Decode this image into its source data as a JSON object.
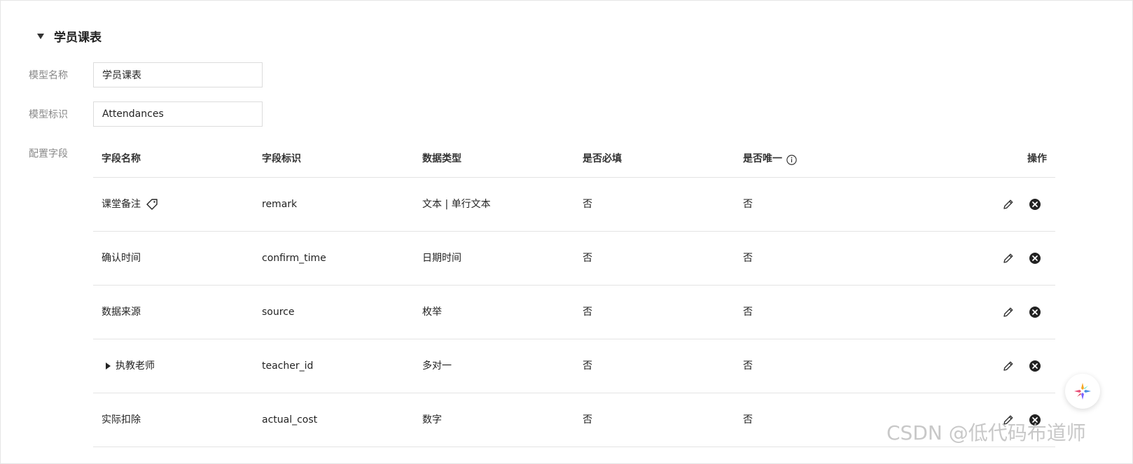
{
  "section": {
    "title": "学员课表"
  },
  "form": {
    "model_name_label": "模型名称",
    "model_name_value": "学员课表",
    "model_id_label": "模型标识",
    "model_id_value": "Attendances",
    "fields_label": "配置字段"
  },
  "table": {
    "headers": {
      "field_name": "字段名称",
      "field_id": "字段标识",
      "data_type": "数据类型",
      "required": "是否必填",
      "unique": "是否唯一",
      "actions": "操作"
    },
    "rows": [
      {
        "name": "课堂备注",
        "id": "remark",
        "type": "文本 | 单行文本",
        "required": "否",
        "unique": "否",
        "has_tag": true,
        "expandable": false
      },
      {
        "name": "确认时间",
        "id": "confirm_time",
        "type": "日期时间",
        "required": "否",
        "unique": "否",
        "has_tag": false,
        "expandable": false
      },
      {
        "name": "数据来源",
        "id": "source",
        "type": "枚举",
        "required": "否",
        "unique": "否",
        "has_tag": false,
        "expandable": false
      },
      {
        "name": "执教老师",
        "id": "teacher_id",
        "type": "多对一",
        "required": "否",
        "unique": "否",
        "has_tag": false,
        "expandable": true
      },
      {
        "name": "实际扣除",
        "id": "actual_cost",
        "type": "数字",
        "required": "否",
        "unique": "否",
        "has_tag": false,
        "expandable": false
      }
    ]
  },
  "icons": {
    "section_caret": "caret-down-icon",
    "unique_info": "info-icon",
    "tag": "tag-icon",
    "expand": "caret-right-icon",
    "edit": "pencil-icon",
    "delete": "close-circle-icon"
  },
  "watermark": "CSDN @低代码布道师"
}
